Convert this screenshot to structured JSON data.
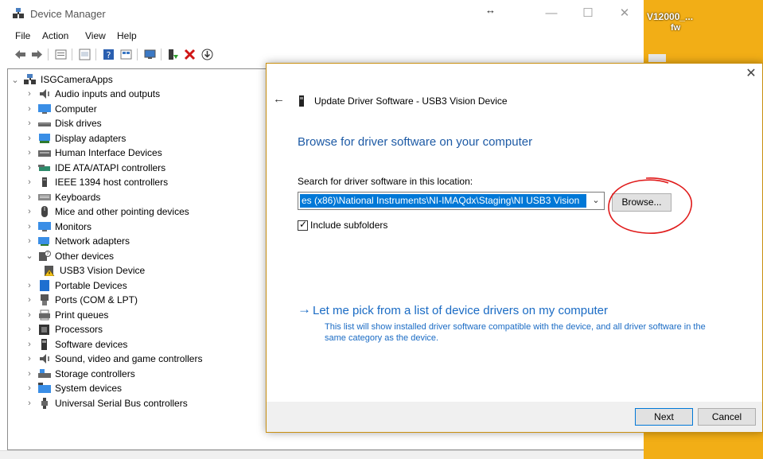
{
  "window": {
    "title": "Device Manager",
    "resize_glyph": "↔",
    "minimize": "—",
    "maximize": "☐",
    "close": "✕"
  },
  "menu": [
    "File",
    "Action",
    "View",
    "Help"
  ],
  "toolbar_icons": [
    "back-arrow-icon",
    "forward-arrow-icon",
    "properties-icon",
    "show-hidden-icon",
    "help-icon",
    "view-icon",
    "monitor-icon",
    "update-driver-icon",
    "uninstall-icon",
    "download-icon"
  ],
  "tree": {
    "root": "ISGCameraApps",
    "items": [
      {
        "label": "Audio inputs and outputs",
        "icon": "speaker-icon",
        "expanded": false
      },
      {
        "label": "Computer",
        "icon": "computer-icon",
        "expanded": false
      },
      {
        "label": "Disk drives",
        "icon": "disk-drive-icon",
        "expanded": false
      },
      {
        "label": "Display adapters",
        "icon": "display-adapter-icon",
        "expanded": false
      },
      {
        "label": "Human Interface Devices",
        "icon": "hid-icon",
        "expanded": false
      },
      {
        "label": "IDE ATA/ATAPI controllers",
        "icon": "ide-controller-icon",
        "expanded": false
      },
      {
        "label": "IEEE 1394 host controllers",
        "icon": "ieee1394-icon",
        "expanded": false
      },
      {
        "label": "Keyboards",
        "icon": "keyboard-icon",
        "expanded": false
      },
      {
        "label": "Mice and other pointing devices",
        "icon": "mouse-icon",
        "expanded": false
      },
      {
        "label": "Monitors",
        "icon": "monitor-icon",
        "expanded": false
      },
      {
        "label": "Network adapters",
        "icon": "network-adapter-icon",
        "expanded": false
      },
      {
        "label": "Other devices",
        "icon": "other-devices-icon",
        "expanded": true
      },
      {
        "label": "USB3 Vision Device",
        "icon": "warning-device-icon",
        "child": true
      },
      {
        "label": "Portable Devices",
        "icon": "portable-device-icon",
        "expanded": false
      },
      {
        "label": "Ports (COM & LPT)",
        "icon": "port-icon",
        "expanded": false
      },
      {
        "label": "Print queues",
        "icon": "printer-icon",
        "expanded": false
      },
      {
        "label": "Processors",
        "icon": "processor-icon",
        "expanded": false
      },
      {
        "label": "Software devices",
        "icon": "software-device-icon",
        "expanded": false
      },
      {
        "label": "Sound, video and game controllers",
        "icon": "sound-icon",
        "expanded": false
      },
      {
        "label": "Storage controllers",
        "icon": "storage-controller-icon",
        "expanded": false
      },
      {
        "label": "System devices",
        "icon": "system-devices-icon",
        "expanded": false
      },
      {
        "label": "Universal Serial Bus controllers",
        "icon": "usb-icon",
        "expanded": false
      }
    ]
  },
  "background": {
    "icon_text_1": "V12000_...",
    "icon_text_2": "fw",
    "color": "#f2ae16"
  },
  "dialog": {
    "close": "✕",
    "back": "←",
    "header": "Update Driver Software - USB3 Vision Device",
    "heading": "Browse for driver software on your computer",
    "search_label": "Search for driver software in this location:",
    "path_value": "es (x86)\\National Instruments\\NI-IMAQdx\\Staging\\NI USB3 Vision",
    "browse_label": "Browse...",
    "include_subfolders_label": "Include subfolders",
    "include_subfolders_checked": true,
    "checkmark": "✓",
    "pick_arrow": "→",
    "pick_title": "Let me pick from a list of device drivers on my computer",
    "pick_desc": "This list will show installed driver software compatible with the device, and all driver software in the same category as the device.",
    "next_label": "Next",
    "cancel_label": "Cancel",
    "accent_color": "#1a6bc4",
    "highlight_color": "#0078d7",
    "annotation_color": "#e01b1b"
  }
}
